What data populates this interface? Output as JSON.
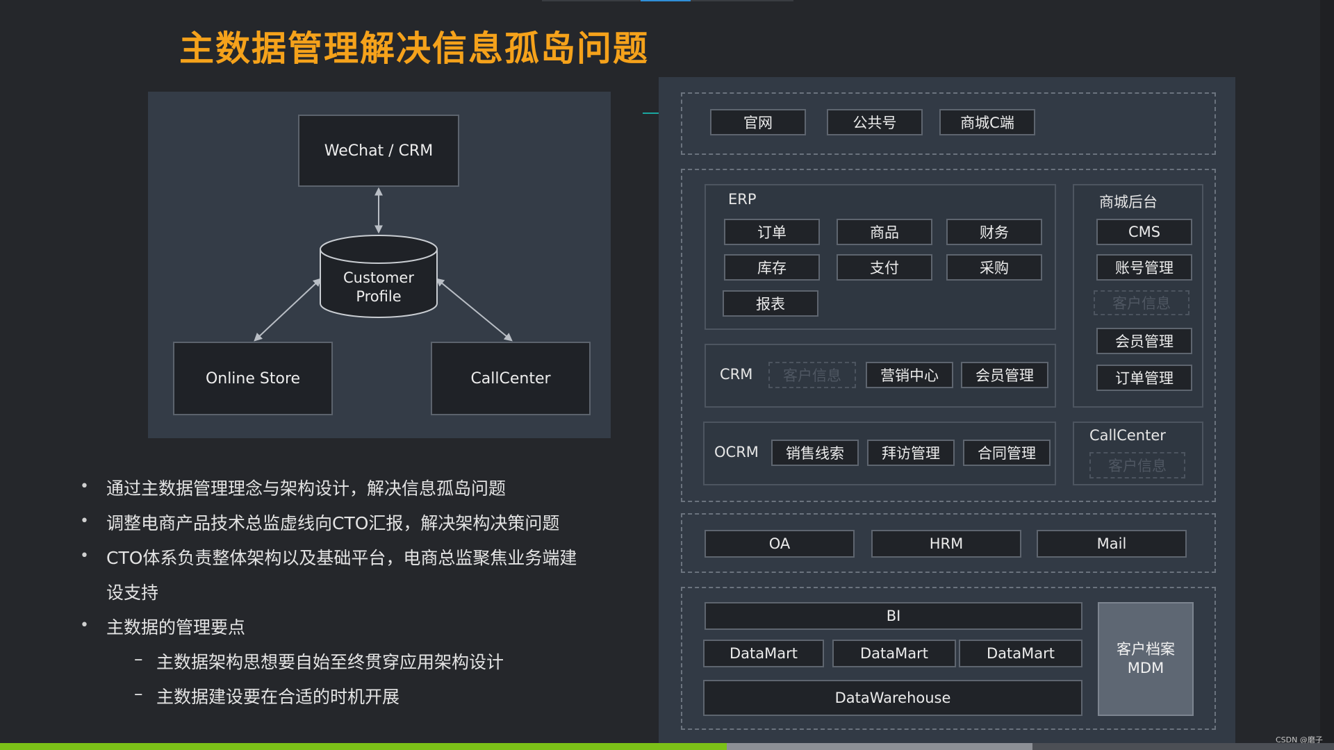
{
  "title": "主数据管理解决信息孤岛问题",
  "left_diagram": {
    "top_node": "WeChat / CRM",
    "center_node_line1": "Customer",
    "center_node_line2": "Profile",
    "left_node": "Online Store",
    "right_node": "CallCenter"
  },
  "bullets": [
    "通过主数据管理理念与架构设计，解决信息孤岛问题",
    "调整电商产品技术总监虚线向CTO汇报，解决架构决策问题",
    "CTO体系负责整体架构以及基础平台，电商总监聚焦业务端建",
    "设支持",
    "主数据的管理要点"
  ],
  "sub_bullets": [
    "主数据架构思想要自始至终贯穿应用架构设计",
    "主数据建设要在合适的时机开展"
  ],
  "sub_bullet_marker": "–",
  "architecture": {
    "channels": [
      "官网",
      "公共号",
      "商城C端"
    ],
    "erp": {
      "label": "ERP",
      "modules": [
        "订单",
        "商品",
        "财务",
        "库存",
        "支付",
        "采购",
        "报表"
      ]
    },
    "mall_backend": {
      "label": "商城后台",
      "modules": [
        "CMS",
        "账号管理",
        "客户信息",
        "会员管理",
        "订单管理"
      ]
    },
    "crm": {
      "label": "CRM",
      "modules": [
        "客户信息",
        "营销中心",
        "会员管理"
      ]
    },
    "ocrm": {
      "label": "OCRM",
      "modules": [
        "销售线索",
        "拜访管理",
        "合同管理"
      ]
    },
    "callcenter": {
      "label": "CallCenter",
      "modules": [
        "客户信息"
      ]
    },
    "office": [
      "OA",
      "HRM",
      "Mail"
    ],
    "data": {
      "bi": "BI",
      "datamarts": [
        "DataMart",
        "DataMart",
        "DataMart"
      ],
      "warehouse": "DataWarehouse",
      "mdm_line1": "客户档案",
      "mdm_line2": "MDM"
    }
  },
  "watermark": "CSDN @磨子",
  "colors": {
    "title": "#f5a21b",
    "accent": "#1aa7a0",
    "progress": "#7cc118"
  },
  "video_progress": 0.545
}
